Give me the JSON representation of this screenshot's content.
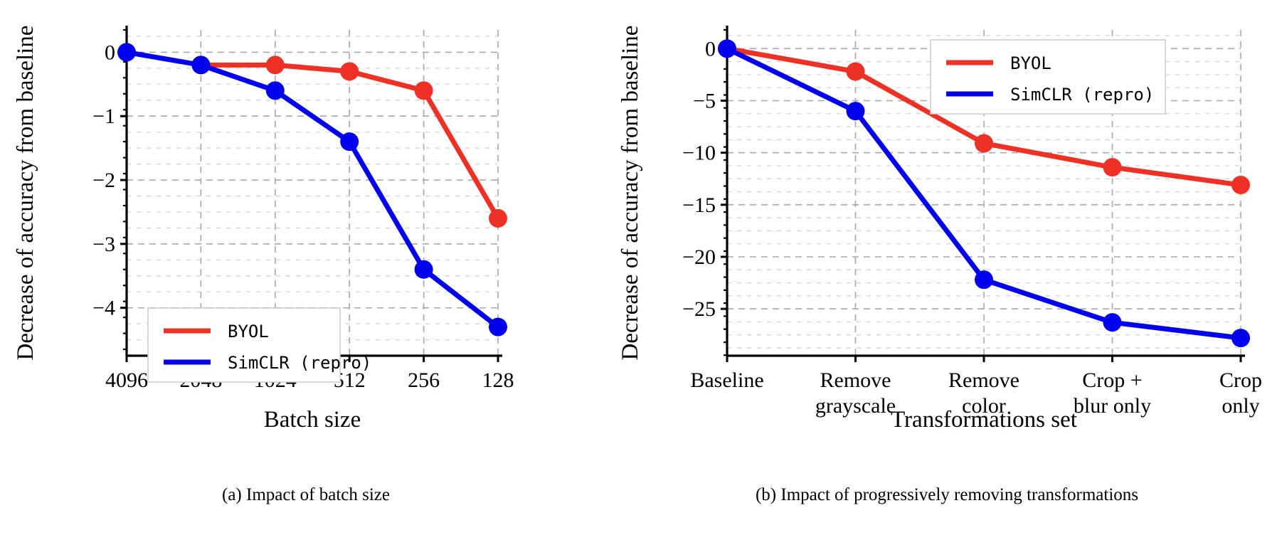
{
  "figure": {
    "panel_a": {
      "caption": "(a) Impact of batch size",
      "ylabel": "Decrease of accuracy from baseline",
      "xlabel": "Batch size",
      "legend": {
        "byol": "BYOL",
        "simclr": "SimCLR (repro)"
      }
    },
    "panel_b": {
      "caption": "(b) Impact of progressively removing transformations",
      "ylabel": "Decrease of accuracy from baseline",
      "xlabel": "Transformations set",
      "legend": {
        "byol": "BYOL",
        "simclr": "SimCLR (repro)"
      }
    }
  },
  "colors": {
    "byol": "#EE3124",
    "simclr": "#0000EE",
    "grid": "#b0b0b0",
    "axis": "#000000",
    "background": "#ffffff"
  },
  "chart_data": [
    {
      "type": "line",
      "id": "panel-a",
      "title": "(a) Impact of batch size",
      "xlabel": "Batch size",
      "ylabel": "Decrease of accuracy from baseline",
      "categories": [
        "4096",
        "2048",
        "1024",
        "512",
        "256",
        "128"
      ],
      "yticks": [
        0,
        -1,
        -2,
        -3,
        -4
      ],
      "ytick_labels": [
        "0",
        "−1",
        "−2",
        "−3",
        "−4"
      ],
      "ylim": [
        -4.75,
        0.35
      ],
      "grid": true,
      "legend_position": "lower left",
      "series": [
        {
          "name": "BYOL",
          "color": "#EE3124",
          "x": [
            "2048",
            "1024",
            "512",
            "256",
            "128"
          ],
          "values": [
            -0.2,
            -0.2,
            -0.3,
            -0.6,
            -2.6
          ]
        },
        {
          "name": "SimCLR (repro)",
          "color": "#0000EE",
          "x": [
            "4096",
            "2048",
            "1024",
            "512",
            "256",
            "128"
          ],
          "values": [
            0.0,
            -0.2,
            -0.6,
            -1.4,
            -3.4,
            -4.3
          ]
        }
      ]
    },
    {
      "type": "line",
      "id": "panel-b",
      "title": "(b) Impact of progressively removing transformations",
      "xlabel": "Transformations set",
      "ylabel": "Decrease of accuracy from baseline",
      "categories": [
        "Baseline",
        "Remove grayscale",
        "Remove color",
        "Crop + blur only",
        "Crop only"
      ],
      "category_lines": [
        [
          "Baseline"
        ],
        [
          "Remove",
          "grayscale"
        ],
        [
          "Remove",
          "color"
        ],
        [
          "Crop +",
          "blur only"
        ],
        [
          "Crop",
          "only"
        ]
      ],
      "yticks": [
        0,
        -5,
        -10,
        -15,
        -20,
        -25
      ],
      "ytick_labels": [
        "0",
        "−5",
        "−10",
        "−15",
        "−20",
        "−25"
      ],
      "ylim": [
        -29.5,
        1.8
      ],
      "grid": true,
      "legend_position": "upper right",
      "series": [
        {
          "name": "BYOL",
          "color": "#EE3124",
          "x": [
            "Baseline",
            "Remove grayscale",
            "Remove color",
            "Crop + blur only",
            "Crop only"
          ],
          "values": [
            0.0,
            -2.2,
            -9.1,
            -11.4,
            -13.1
          ]
        },
        {
          "name": "SimCLR (repro)",
          "color": "#0000EE",
          "x": [
            "Baseline",
            "Remove grayscale",
            "Remove color",
            "Crop + blur only",
            "Crop only"
          ],
          "values": [
            0.0,
            -6.0,
            -22.2,
            -26.3,
            -27.8
          ]
        }
      ]
    }
  ]
}
